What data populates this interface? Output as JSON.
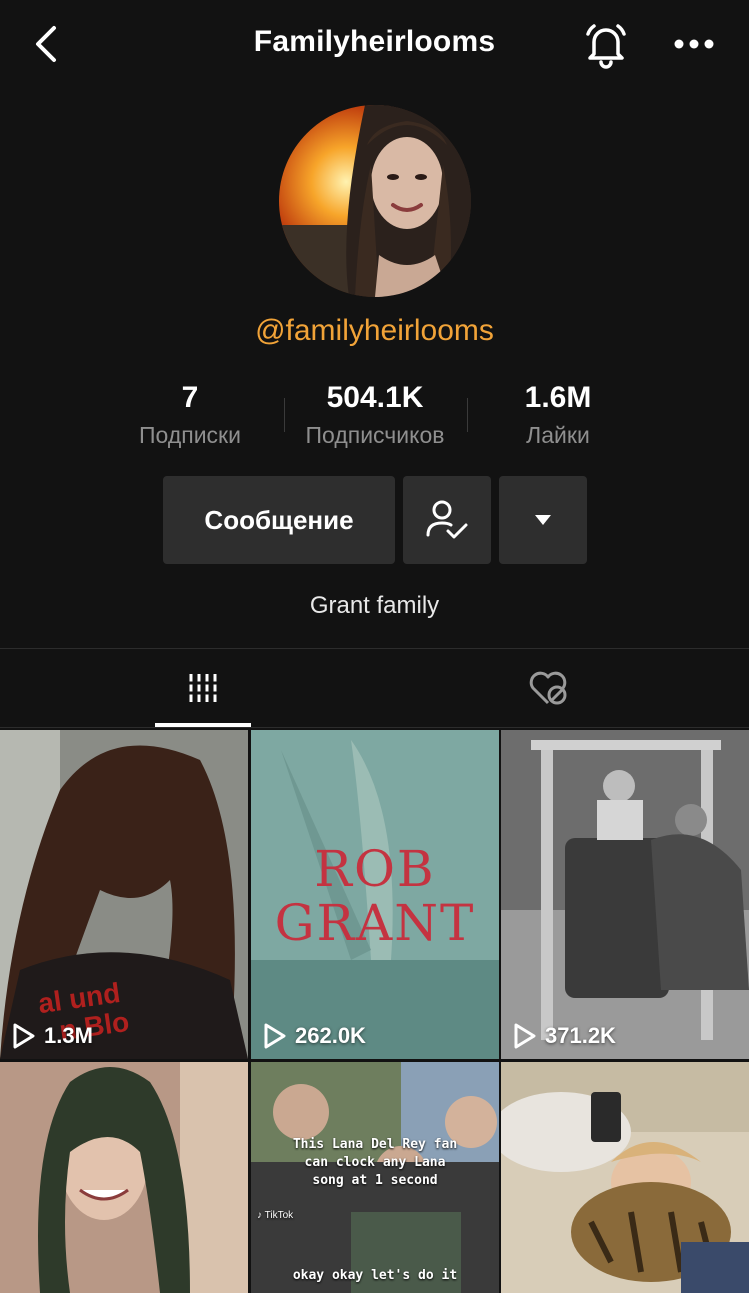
{
  "header": {
    "title": "Familyheirlooms"
  },
  "profile": {
    "username": "@familyheirlooms",
    "bio": "Grant family"
  },
  "stats": [
    {
      "value": "7",
      "label": "Подписки"
    },
    {
      "value": "504.1K",
      "label": "Подписчиков"
    },
    {
      "value": "1.6M",
      "label": "Лайки"
    }
  ],
  "actions": {
    "message_label": "Сообщение"
  },
  "videos": [
    {
      "views": "1.3M"
    },
    {
      "views": "262.0K",
      "overlay_text": [
        "ROB",
        "GRANT"
      ]
    },
    {
      "views": "371.2K"
    },
    {
      "views": ""
    },
    {
      "views": "",
      "overlay_text": [
        "This Lana Del Rey fan",
        "can clock any Lana",
        "song at 1 second"
      ],
      "caption": "okay okay let's do it",
      "watermark": "TikTok"
    },
    {
      "views": ""
    }
  ],
  "colors": {
    "accent": "#f1a338",
    "background": "#121212",
    "button": "#2e2e2e"
  }
}
